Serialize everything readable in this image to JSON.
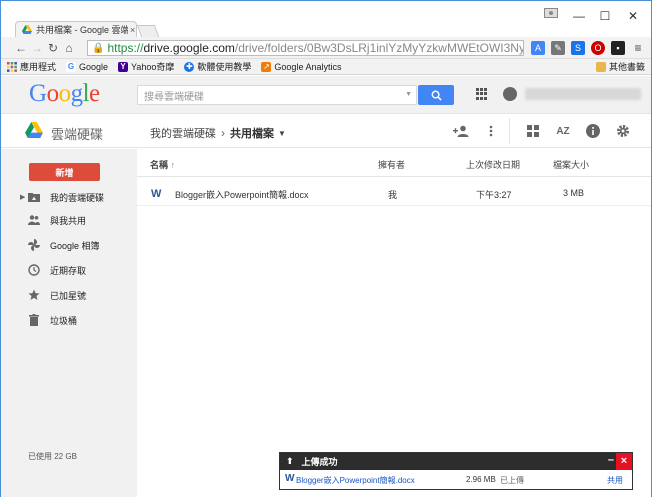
{
  "browser": {
    "tab_title": "共用檔案 - Google 雲端硬碟",
    "tab_close": "×",
    "url_scheme": "https://",
    "url_host": "drive.google.com",
    "url_path": "/drive/folders/0Bw3DsLRj1inlYzMyYzkwMWEtOWI3Ny00Zjg2"
  },
  "bookmarks": {
    "items": [
      {
        "label": "應用程式",
        "icon": "apps-grid-icon"
      },
      {
        "label": "Google",
        "icon": "google-g-icon"
      },
      {
        "label": "Yahoo奇摩",
        "icon": "yahoo-icon"
      },
      {
        "label": "軟體使用教學",
        "icon": "tutorial-icon"
      },
      {
        "label": "Google Analytics",
        "icon": "analytics-icon"
      }
    ],
    "other_label": "其他書籤"
  },
  "google_header": {
    "logo_letters": [
      "G",
      "o",
      "o",
      "g",
      "l",
      "e"
    ],
    "search_placeholder": "搜尋雲端硬碟"
  },
  "drive_bar": {
    "product_name": "雲端硬碟",
    "breadcrumb_root": "我的雲端硬碟",
    "breadcrumb_sep": "›",
    "breadcrumb_current": "共用檔案",
    "sort_icon_text": "AZ"
  },
  "sidebar": {
    "new_button": "新增",
    "items": [
      {
        "label": "我的雲端硬碟",
        "icon": "drive-folder-icon"
      },
      {
        "label": "與我共用",
        "icon": "shared-people-icon"
      },
      {
        "label": "Google 相簿",
        "icon": "photos-pinwheel-icon"
      },
      {
        "label": "近期存取",
        "icon": "clock-icon"
      },
      {
        "label": "已加星號",
        "icon": "star-icon"
      },
      {
        "label": "垃圾桶",
        "icon": "trash-icon"
      }
    ],
    "usage": "已使用 22 GB"
  },
  "file_list": {
    "columns": {
      "name": "名稱",
      "owner": "擁有者",
      "modified": "上次修改日期",
      "size": "檔案大小"
    },
    "rows": [
      {
        "icon_letter": "W",
        "name": "Blogger嵌入Powerpoint簡報.docx",
        "owner": "我",
        "modified": "下午3:27",
        "size": "3 MB"
      }
    ]
  },
  "upload_panel": {
    "title": "上傳成功",
    "minimize": "–",
    "close": "×",
    "file": {
      "icon_letter": "W",
      "name": "Blogger嵌入Powerpoint簡報.docx",
      "size": "2.96 MB",
      "status": "已上傳",
      "share": "共用"
    }
  },
  "colors": {
    "accent_blue": "#4285f4",
    "new_button_red": "#dd4b39",
    "word_blue": "#2b5797",
    "close_red": "#e81123"
  }
}
